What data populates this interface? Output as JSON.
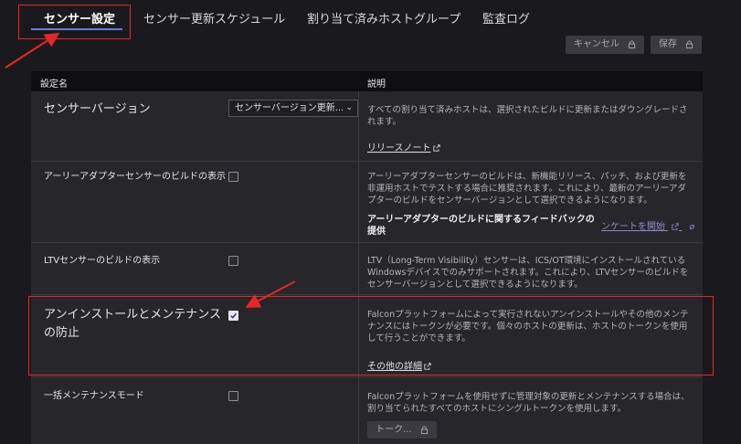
{
  "tabs": [
    {
      "label": "センサー設定",
      "active": true
    },
    {
      "label": "センサー更新スケジュール",
      "active": false
    },
    {
      "label": "割り当て済みホストグループ",
      "active": false
    },
    {
      "label": "監査ログ",
      "active": false
    }
  ],
  "toolbar": {
    "cancel_label": "キャンセル",
    "save_label": "保存"
  },
  "table": {
    "header": {
      "name": "設定名",
      "description": "説明"
    },
    "rows": [
      {
        "name": "センサーバージョン",
        "control": "select",
        "select_value": "センサーバージョン更新...",
        "description": "すべての割り当て済みホストは、選択されたビルドに更新またはダウングレードされます。",
        "link": "リリースノート"
      },
      {
        "name": "アーリーアダプターセンサーのビルドの表示",
        "control": "checkbox",
        "checked": false,
        "description": "アーリーアダプターセンサーのビルドは、新機能リリース、パッチ、および更新を非運用ホストでテストする場合に推奨されます。これにより、最新のアーリーアダプターのビルドをセンサーバージョンとして選択できるようになります。",
        "feedback_label": "アーリーアダプターのビルドに関するフィードバックの提供",
        "feedback_link": "ンケートを開始"
      },
      {
        "name": "LTVセンサーのビルドの表示",
        "control": "checkbox",
        "checked": false,
        "description": "LTV（Long-Term Visibility）センサーは、ICS/OT環境にインストールされているWindowsデバイスでのみサポートされます。これにより、LTVセンサーのビルドをセンサーバージョンとして選択できるようになります。"
      },
      {
        "name": "アンインストールとメンテナンスの防止",
        "control": "checkbox",
        "checked": true,
        "description": "Falconプラットフォームによって実行されないアンインストールやその他のメンテナンスにはトークンが必要です。個々のホストの更新は、ホストのトークンを使用して行うことができます。",
        "link": "その他の詳細"
      },
      {
        "name": "一括メンテナンスモード",
        "control": "checkbox",
        "checked": false,
        "description": "Falconプラットフォームを使用せずに管理対象の更新とメンテナンスする場合は、割り当てられたすべてのホストにシングルトークンを使用します。",
        "button_label": "トーク..."
      }
    ]
  },
  "colors": {
    "highlight": "#e8262a",
    "tab_underline": "#6e7bd6",
    "panel": "#26262b",
    "background": "#1a1a1e"
  }
}
